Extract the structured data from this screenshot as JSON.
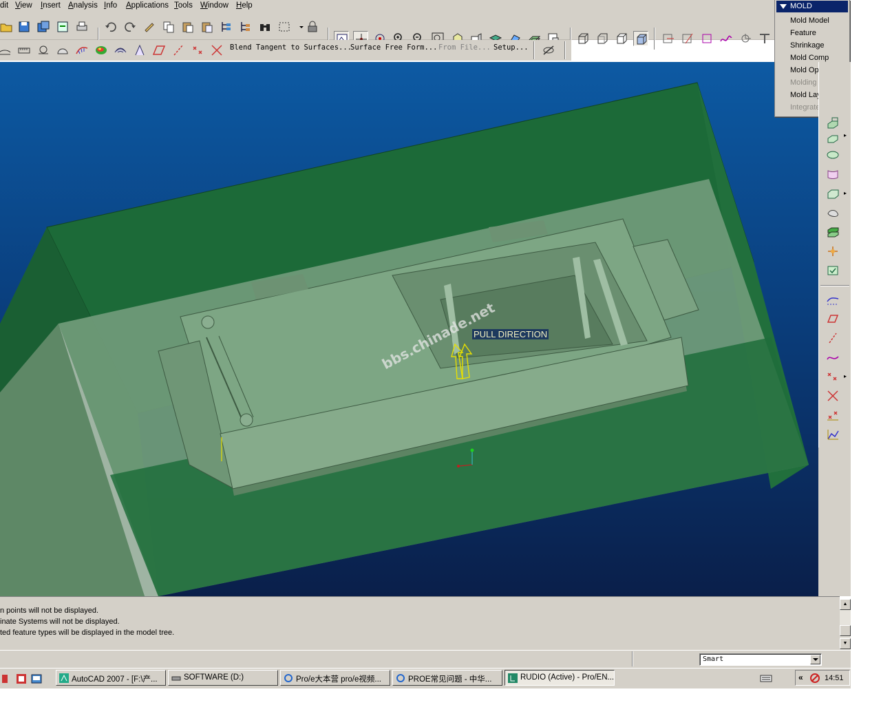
{
  "menubar": {
    "items": [
      "dit",
      "View",
      "Insert",
      "Analysis",
      "Info",
      "Applications",
      "Tools",
      "Window",
      "Help"
    ],
    "underline": [
      "",
      "V",
      "I",
      "A",
      "I",
      "A",
      "T",
      "W",
      "H"
    ]
  },
  "toolbar2": {
    "blend_tangent": "Blend Tangent to Surfaces...",
    "surface_free_form": "Surface Free Form...",
    "from_file": "From File...",
    "setup": "Setup..."
  },
  "viewport": {
    "pull_direction_label": "PULL DIRECTION",
    "watermark": "bbs.chinade.net",
    "colors": {
      "mold_dark": "#1f6a3a",
      "mold_light": "#7a9f7e",
      "arrow": "#e8e000"
    }
  },
  "mold_menu": {
    "title": "MOLD",
    "items": [
      {
        "label": "Mold Model",
        "enabled": true
      },
      {
        "label": "Feature",
        "enabled": true
      },
      {
        "label": "Shrinkage",
        "enabled": true
      },
      {
        "label": "Mold Comp",
        "enabled": true
      },
      {
        "label": "Mold Opening",
        "enabled": true
      },
      {
        "label": "Molding",
        "enabled": false
      },
      {
        "label": "Mold Layout",
        "enabled": true
      },
      {
        "label": "Integrate",
        "enabled": false
      }
    ]
  },
  "messages": [
    "n points will not be displayed.",
    "inate Systems will not be displayed.",
    "ted feature types will be displayed in the model tree."
  ],
  "filter": {
    "value": "Smart"
  },
  "taskbar": {
    "tasks": [
      {
        "label": "AutoCAD 2007 - [F:\\产...",
        "active": false
      },
      {
        "label": "SOFTWARE (D:)",
        "active": false
      },
      {
        "label": "Pro/e大本营 pro/e视频...",
        "active": false
      },
      {
        "label": "PROE常见问题 - 中华...",
        "active": false
      },
      {
        "label": "RUDIO (Active) - Pro/EN...",
        "active": true
      }
    ],
    "clock": "14:51",
    "tray_chevron": "«"
  }
}
